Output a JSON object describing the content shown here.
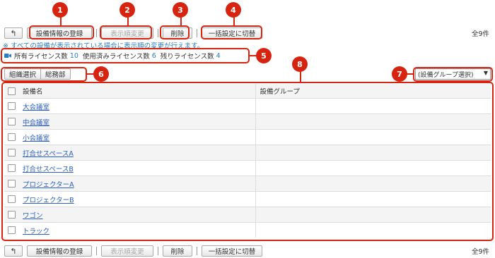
{
  "toolbar": {
    "back_icon": "↰",
    "register_label": "設備情報の登録",
    "reorder_label": "表示順変更",
    "delete_label": "削除",
    "bulk_label": "一括設定に切替",
    "count": "全9件"
  },
  "note": "※ すべての設備が表示されている場合に表示順の変更が行えます。",
  "license": {
    "owned_label": "所有ライセンス数",
    "owned_value": "10",
    "used_label": "使用済みライセンス数",
    "used_value": "6",
    "remaining_label": "残りライセンス数",
    "remaining_value": "4"
  },
  "org": {
    "select_label": "組織選択",
    "current": "総務部"
  },
  "group_select": {
    "value": "(設備グループ選択)",
    "caret": "▼"
  },
  "table": {
    "headers": [
      "設備名",
      "設備グループ"
    ],
    "rows": [
      "大会議室",
      "中会議室",
      "小会議室",
      "打合せスペースA",
      "打合せスペースB",
      "プロジェクターA",
      "プロジェクターB",
      "ワゴン",
      "トラック"
    ]
  },
  "markers": [
    "1",
    "2",
    "3",
    "4",
    "5",
    "6",
    "7",
    "8"
  ],
  "colors": {
    "accent": "#d62410",
    "link": "#2a5fbf",
    "info": "#2a7dbf"
  }
}
